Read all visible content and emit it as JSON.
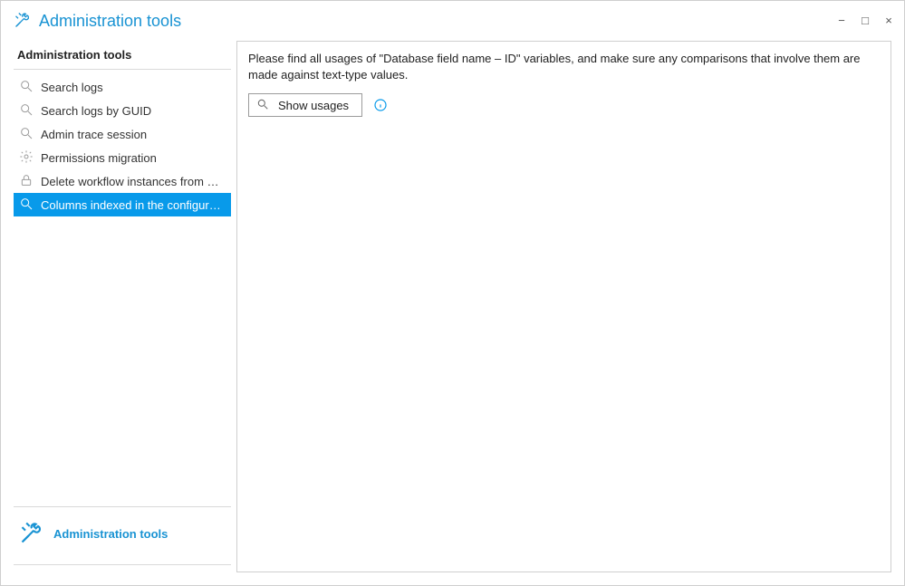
{
  "title": "Administration tools",
  "window_controls": {
    "minimize": "−",
    "maximize": "□",
    "close": "×"
  },
  "sidebar": {
    "header": "Administration tools",
    "items": [
      {
        "icon": "search-icon",
        "label": "Search logs"
      },
      {
        "icon": "search-icon",
        "label": "Search logs by GUID"
      },
      {
        "icon": "search-icon",
        "label": "Admin trace session"
      },
      {
        "icon": "gear-icon",
        "label": "Permissions migration"
      },
      {
        "icon": "lock-icon",
        "label": "Delete workflow instances from process"
      },
      {
        "icon": "search-icon",
        "label": "Columns indexed in the configuration",
        "selected": true
      }
    ],
    "footer_label": "Administration tools"
  },
  "content": {
    "instructions": "Please find all usages of \"Database field name – ID\" variables, and make sure any comparisons that involve them are made against text-type values.",
    "show_usages_label": "Show usages"
  }
}
